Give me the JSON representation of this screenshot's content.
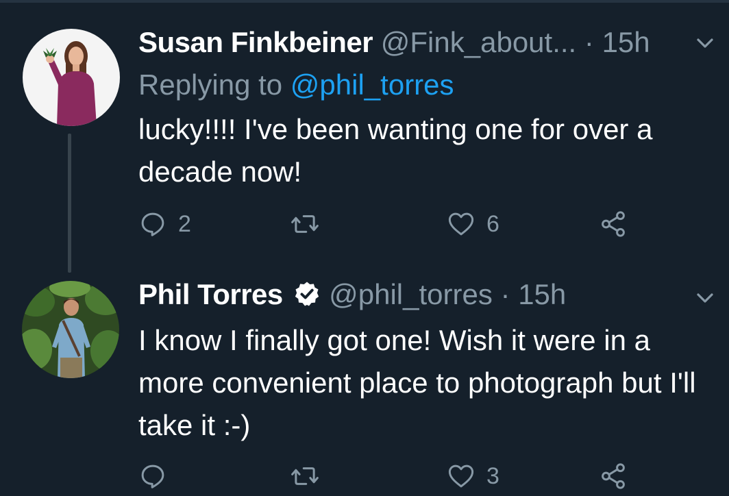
{
  "tweets": [
    {
      "name": "Susan Finkbeiner",
      "handle": "@Fink_about...",
      "dot": "·",
      "time": "15h",
      "replying_prefix": "Replying to",
      "replying_handle": "@phil_torres",
      "text": "lucky!!!! I've been wanting one for over a decade now!",
      "verified": false,
      "actions": {
        "reply_count": "2",
        "retweet_count": "",
        "like_count": "6"
      }
    },
    {
      "name": "Phil Torres",
      "handle": "@phil_torres",
      "dot": "·",
      "time": "15h",
      "text": "I know I finally got one! Wish it were in a more convenient place to photograph but I'll take it :-)",
      "verified": true,
      "actions": {
        "reply_count": "",
        "retweet_count": "",
        "like_count": "3"
      }
    }
  ],
  "icons": {
    "reply": "reply-icon",
    "retweet": "retweet-icon",
    "like": "heart-icon",
    "share": "share-icon",
    "menu": "chevron-down-icon",
    "verified": "verified-badge-icon"
  },
  "colors": {
    "background": "#15202b",
    "text_primary": "#ffffff",
    "text_secondary": "#8899a6",
    "link": "#1da1f2",
    "thread_line": "#38444d"
  }
}
